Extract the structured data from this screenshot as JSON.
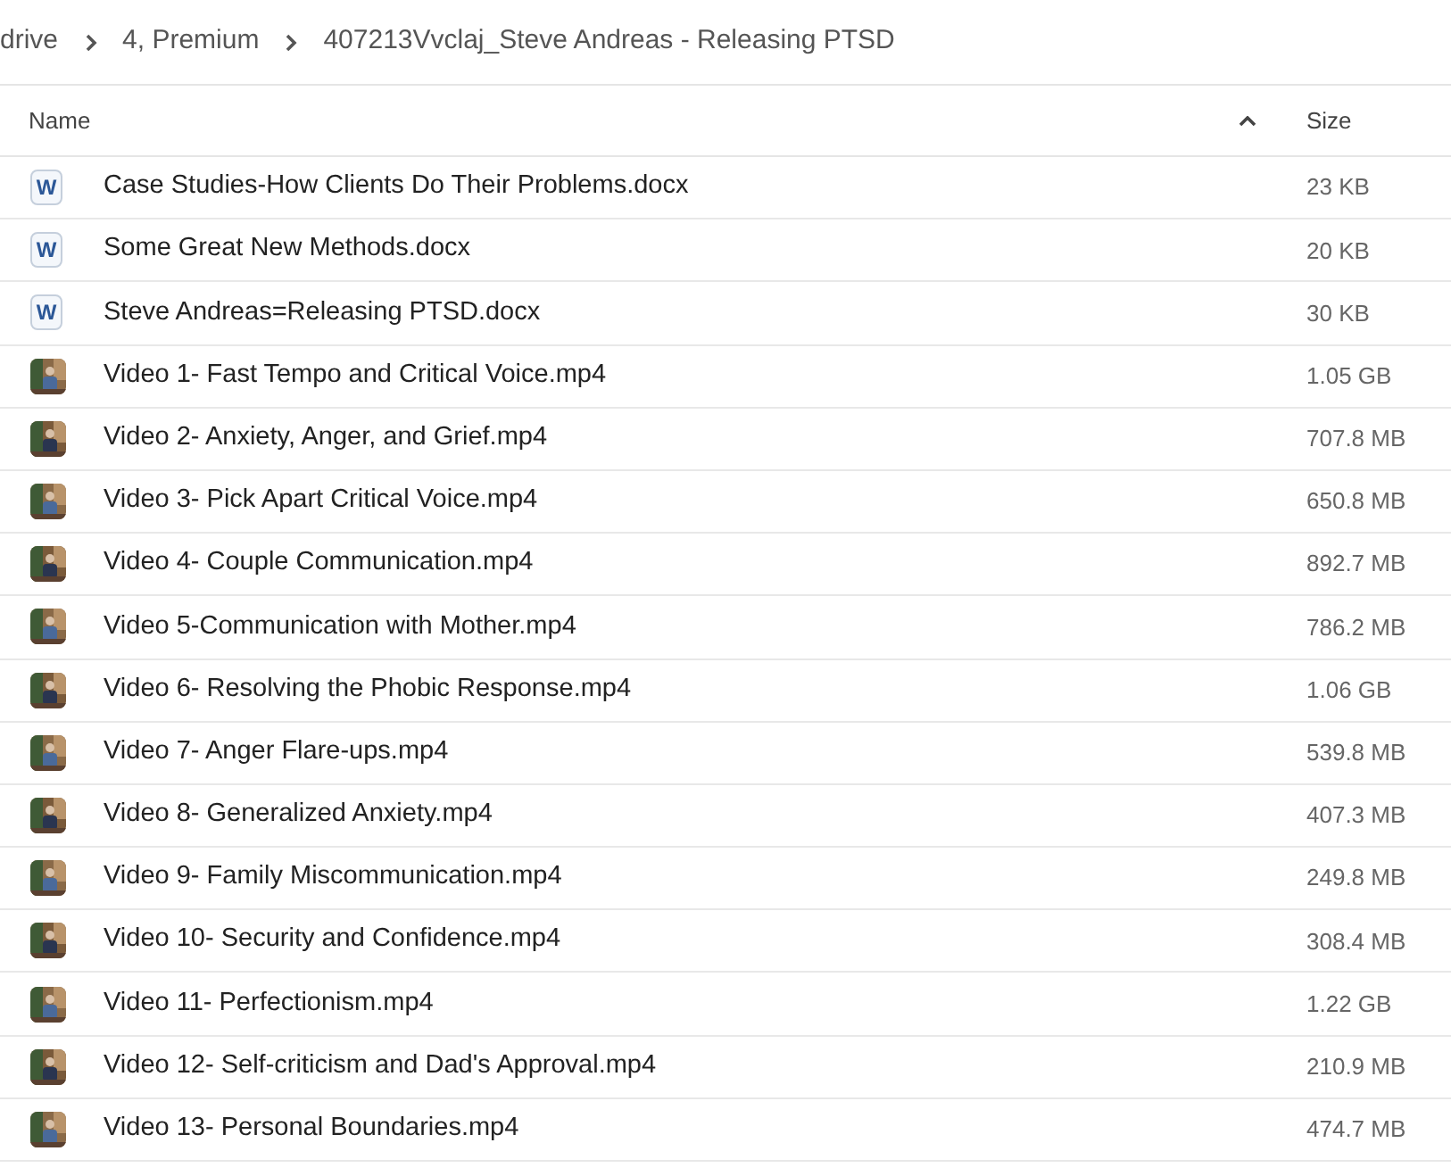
{
  "breadcrumb": [
    "drive",
    "4, Premium",
    "407213Vvclaj_Steve Andreas - Releasing PTSD"
  ],
  "columns": [
    {
      "label": "Name",
      "sorted": true
    },
    {
      "label": "Size",
      "sorted": false
    }
  ],
  "files": [
    {
      "kind": "doc",
      "icon_letter": "W",
      "name": "Case Studies-How Clients Do Their Problems.docx",
      "size": "23 KB"
    },
    {
      "kind": "doc",
      "icon_letter": "W",
      "name": "Some Great New Methods.docx",
      "size": "20 KB"
    },
    {
      "kind": "doc",
      "icon_letter": "W",
      "name": "Steve Andreas=Releasing PTSD.docx",
      "size": "30 KB"
    },
    {
      "kind": "video",
      "name": "Video 1- Fast Tempo and Critical Voice.mp4",
      "size": "1.05 GB"
    },
    {
      "kind": "video",
      "name": "Video 2- Anxiety, Anger, and Grief.mp4",
      "size": "707.8 MB"
    },
    {
      "kind": "video",
      "name": "Video 3- Pick Apart Critical Voice.mp4",
      "size": "650.8 MB"
    },
    {
      "kind": "video",
      "name": "Video 4- Couple Communication.mp4",
      "size": "892.7 MB"
    },
    {
      "kind": "video",
      "name": "Video 5-Communication with Mother.mp4",
      "size": "786.2 MB"
    },
    {
      "kind": "video",
      "name": "Video 6- Resolving the Phobic Response.mp4",
      "size": "1.06 GB"
    },
    {
      "kind": "video",
      "name": "Video 7- Anger Flare-ups.mp4",
      "size": "539.8 MB"
    },
    {
      "kind": "video",
      "name": "Video 8- Generalized Anxiety.mp4",
      "size": "407.3 MB"
    },
    {
      "kind": "video",
      "name": "Video 9- Family Miscommunication.mp4",
      "size": "249.8 MB"
    },
    {
      "kind": "video",
      "name": "Video 10- Security and Confidence.mp4",
      "size": "308.4 MB"
    },
    {
      "kind": "video",
      "name": "Video 11- Perfectionism.mp4",
      "size": "1.22 GB"
    },
    {
      "kind": "video",
      "name": "Video 12- Self-criticism and Dad's Approval.mp4",
      "size": "210.9 MB"
    },
    {
      "kind": "video",
      "name": "Video 13- Personal Boundaries.mp4",
      "size": "474.7 MB"
    }
  ]
}
